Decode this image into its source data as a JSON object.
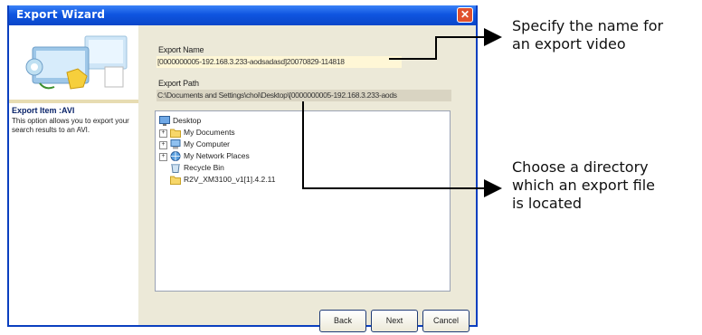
{
  "window": {
    "title": "Export Wizard",
    "close_label": "✕"
  },
  "sidebar": {
    "title": "Export Item :AVI",
    "description": "This option allows you to export your search results to an AVI."
  },
  "export_name": {
    "label": "Export Name",
    "value": "[0000000005-192.168.3.233-aodsadasd]20070829-114818"
  },
  "export_path": {
    "label": "Export Path",
    "value": "C:\\Documents and Settings\\choi\\Desktop\\[0000000005-192.168.3.233-aods"
  },
  "tree": {
    "root": {
      "label": "Desktop",
      "icon": "desktop-icon"
    },
    "items": [
      {
        "label": "My Documents",
        "icon": "folder-icon",
        "expandable": "+"
      },
      {
        "label": "My Computer",
        "icon": "computer-icon",
        "expandable": "+"
      },
      {
        "label": "My Network Places",
        "icon": "network-icon",
        "expandable": "+"
      },
      {
        "label": "Recycle Bin",
        "icon": "recycle-bin-icon",
        "expandable": ""
      },
      {
        "label": "R2V_XM3100_v1[1].4.2.11",
        "icon": "folder-icon",
        "expandable": ""
      }
    ]
  },
  "buttons": {
    "back": "Back",
    "next": "Next",
    "cancel": "Cancel"
  },
  "annotations": {
    "name": [
      "Specify the name for",
      "an export video"
    ],
    "directory": [
      "Choose a directory",
      "which an export file",
      "is located"
    ]
  },
  "colors": {
    "titlebar": "#0a46c9",
    "sidebar_title": "#0a246a",
    "field_highlight": "#fff7d6"
  }
}
